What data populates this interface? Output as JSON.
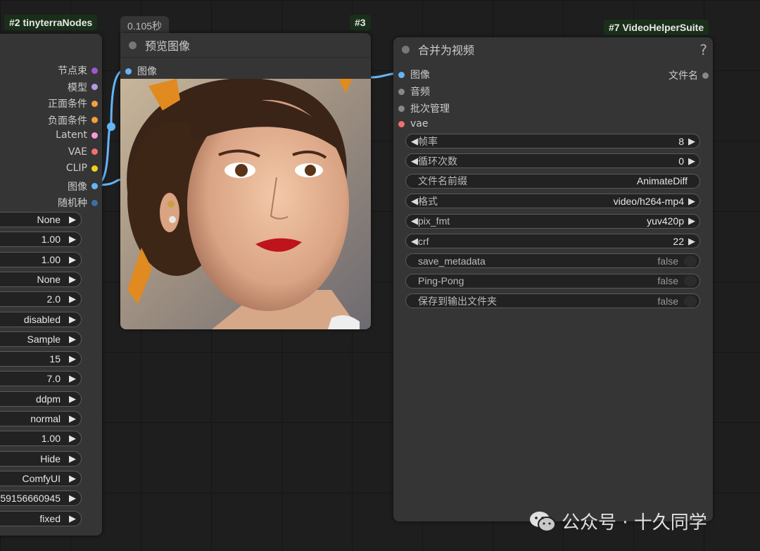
{
  "node2": {
    "badge": "#2 tinyterraNodes",
    "outputs": [
      {
        "label": "节点束",
        "color": "#9b59d0"
      },
      {
        "label": "模型",
        "color": "#b49ae0"
      },
      {
        "label": "正面条件",
        "color": "#f0a040"
      },
      {
        "label": "负面条件",
        "color": "#f0a040"
      },
      {
        "label": "Latent",
        "color": "#f49ad8"
      },
      {
        "label": "VAE",
        "color": "#f07070"
      },
      {
        "label": "CLIP",
        "color": "#f0d020"
      },
      {
        "label": "图像",
        "color": "#64b5f6"
      },
      {
        "label": "随机种",
        "color": "#3d6ea8"
      }
    ],
    "widgets": [
      "None",
      "1.00",
      "1.00",
      "None",
      "2.0",
      "disabled",
      "Sample",
      "15",
      "7.0",
      "ddpm",
      "normal",
      "1.00",
      "Hide",
      "ComfyUI",
      "59156660945",
      "fixed"
    ]
  },
  "node3": {
    "badge": "#3",
    "timer": "0.105秒",
    "title": "预览图像",
    "input_label": "图像",
    "input_color": "#64b5f6"
  },
  "node7": {
    "badge": "#7 VideoHelperSuite",
    "title": "合并为视频",
    "help": "?",
    "inputs": [
      {
        "label": "图像",
        "color": "#64b5f6"
      },
      {
        "label": "音频",
        "color": "#888888"
      },
      {
        "label": "批次管理",
        "color": "#888888"
      },
      {
        "label": "vae",
        "color": "#f07070"
      }
    ],
    "output_label": "文件名",
    "output_color": "#888888",
    "widgets": [
      {
        "label": "帧率",
        "value": "8",
        "type": "number"
      },
      {
        "label": "循环次数",
        "value": "0",
        "type": "number"
      },
      {
        "label": "文件名前缀",
        "value": "AnimateDiff",
        "type": "text"
      },
      {
        "label": "格式",
        "value": "video/h264-mp4",
        "type": "combo"
      },
      {
        "label": "pix_fmt",
        "value": "yuv420p",
        "type": "combo"
      },
      {
        "label": "crf",
        "value": "22",
        "type": "number"
      },
      {
        "label": "save_metadata",
        "value": "false",
        "type": "toggle"
      },
      {
        "label": "Ping-Pong",
        "value": "false",
        "type": "toggle"
      },
      {
        "label": "保存到输出文件夹",
        "value": "false",
        "type": "toggle"
      }
    ]
  },
  "watermark": {
    "text": "公众号 · 十久同学",
    "icon": "wechat-icon"
  },
  "colors": {
    "wire": "#64b5f6",
    "node_bg": "#353535",
    "badge_bg": "#1a2f1a"
  }
}
